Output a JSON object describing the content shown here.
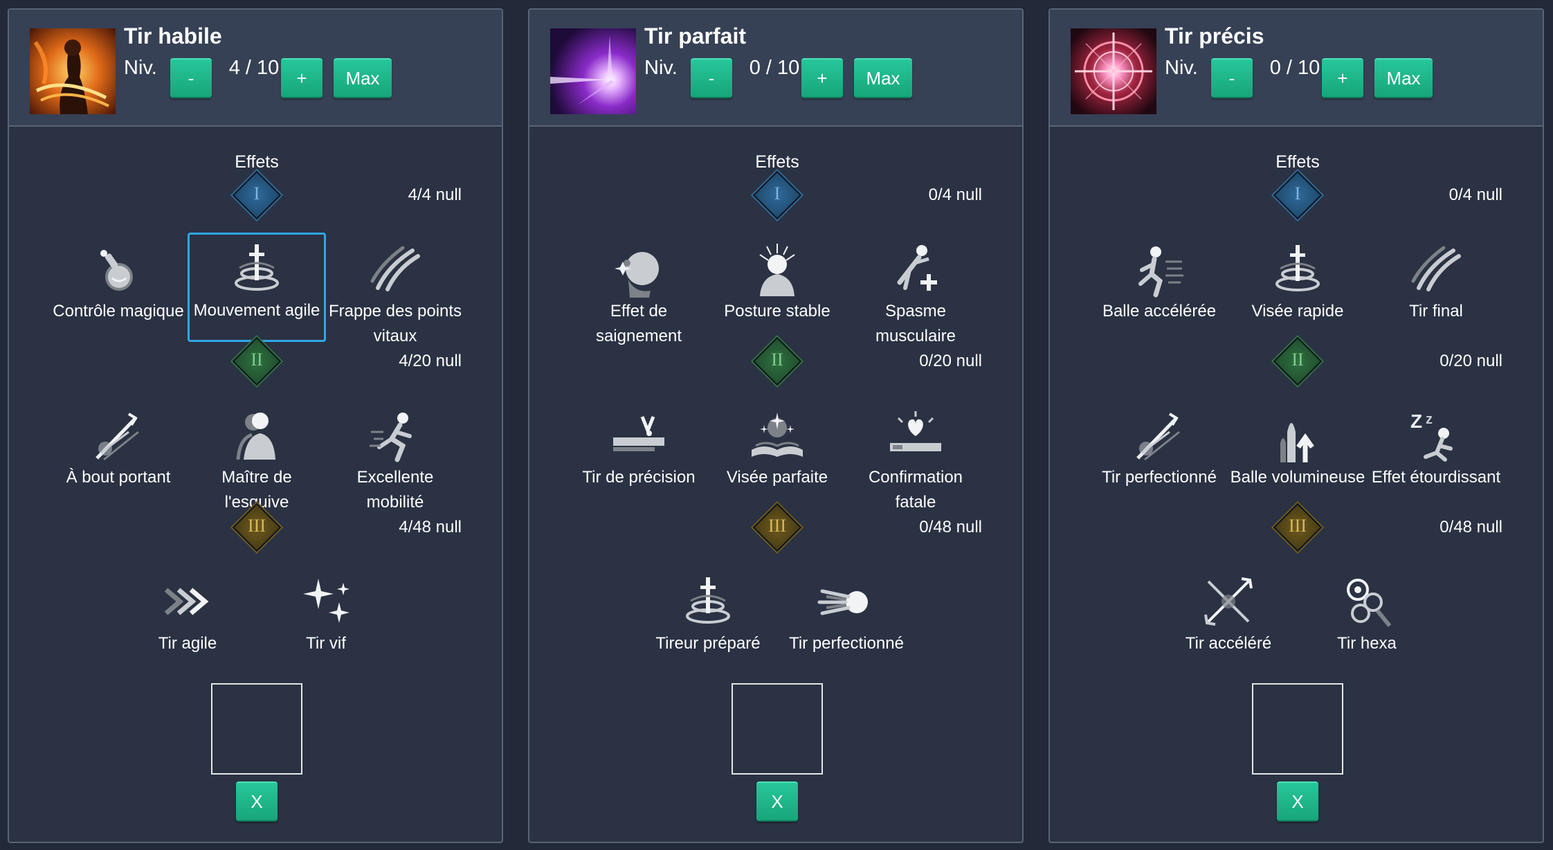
{
  "colors": {
    "accent_green": "#1fb88a",
    "selection_blue": "#2ea7e8",
    "tier1": "#1f4a6e",
    "tier2": "#21502e",
    "tier3": "#5a4a1a"
  },
  "panels": [
    {
      "title": "Tir habile",
      "icon": "skilled-shot-fire-icon",
      "level_label": "Niv.",
      "level_value": "4 / 10",
      "minus_label": "-",
      "plus_label": "+",
      "max_label": "Max",
      "effects_label": "Effets",
      "tiers": [
        {
          "numeral": "I",
          "count": "4/4 null",
          "nodes": [
            {
              "label": "Contrôle magique",
              "icon": "potion-icon"
            },
            {
              "label": "Mouvement agile",
              "icon": "whirl-sword-icon",
              "selected": true
            },
            {
              "label": "Frappe des points vitaux",
              "icon": "claw-slash-icon"
            }
          ]
        },
        {
          "numeral": "II",
          "count": "4/20 null",
          "nodes": [
            {
              "label": "À bout portant",
              "icon": "piercing-shot-icon"
            },
            {
              "label": "Maître de l'esquive",
              "icon": "dodge-master-icon"
            },
            {
              "label": "Excellente mobilité",
              "icon": "running-figure-icon"
            }
          ]
        },
        {
          "numeral": "III",
          "count": "4/48 null",
          "nodes": [
            {
              "label": "Tir agile",
              "icon": "chevrons-icon"
            },
            {
              "label": "Tir vif",
              "icon": "sparks-icon"
            }
          ]
        }
      ],
      "clear_label": "X"
    },
    {
      "title": "Tir parfait",
      "icon": "perfect-shot-purple-icon",
      "level_label": "Niv.",
      "level_value": "0 / 10",
      "minus_label": "-",
      "plus_label": "+",
      "max_label": "Max",
      "effects_label": "Effets",
      "tiers": [
        {
          "numeral": "I",
          "count": "0/4 null",
          "nodes": [
            {
              "label": "Effet de saignement",
              "icon": "bleeding-head-icon"
            },
            {
              "label": "Posture stable",
              "icon": "stable-posture-icon"
            },
            {
              "label": "Spasme musculaire",
              "icon": "muscle-spasm-icon"
            }
          ]
        },
        {
          "numeral": "II",
          "count": "0/20 null",
          "nodes": [
            {
              "label": "Tir de précision",
              "icon": "precision-bar-icon"
            },
            {
              "label": "Visée parfaite",
              "icon": "open-book-icon"
            },
            {
              "label": "Confirmation fatale",
              "icon": "heart-bar-icon"
            }
          ]
        },
        {
          "numeral": "III",
          "count": "0/48 null",
          "nodes": [
            {
              "label": "Tireur préparé",
              "icon": "whirl-sword-icon"
            },
            {
              "label": "Tir perfectionné",
              "icon": "comet-icon"
            }
          ]
        }
      ],
      "clear_label": "X"
    },
    {
      "title": "Tir précis",
      "icon": "precise-shot-crosshair-icon",
      "level_label": "Niv.",
      "level_value": "0 / 10",
      "minus_label": "-",
      "plus_label": "+",
      "max_label": "Max",
      "effects_label": "Effets",
      "tiers": [
        {
          "numeral": "I",
          "count": "0/4 null",
          "nodes": [
            {
              "label": "Balle accélérée",
              "icon": "sprinting-figure-icon"
            },
            {
              "label": "Visée rapide",
              "icon": "whirl-sword-icon"
            },
            {
              "label": "Tir final",
              "icon": "claw-slash-icon"
            }
          ]
        },
        {
          "numeral": "II",
          "count": "0/20 null",
          "nodes": [
            {
              "label": "Tir perfectionné",
              "icon": "piercing-shot-icon"
            },
            {
              "label": "Balle volumineuse",
              "icon": "rocket-arrow-icon"
            },
            {
              "label": "Effet étourdissant",
              "icon": "sleeping-z-icon"
            }
          ]
        },
        {
          "numeral": "III",
          "count": "0/48 null",
          "nodes": [
            {
              "label": "Tir accéléré",
              "icon": "crossed-arrows-icon"
            },
            {
              "label": "Tir hexa",
              "icon": "hex-orbs-icon"
            }
          ]
        }
      ],
      "clear_label": "X"
    }
  ]
}
